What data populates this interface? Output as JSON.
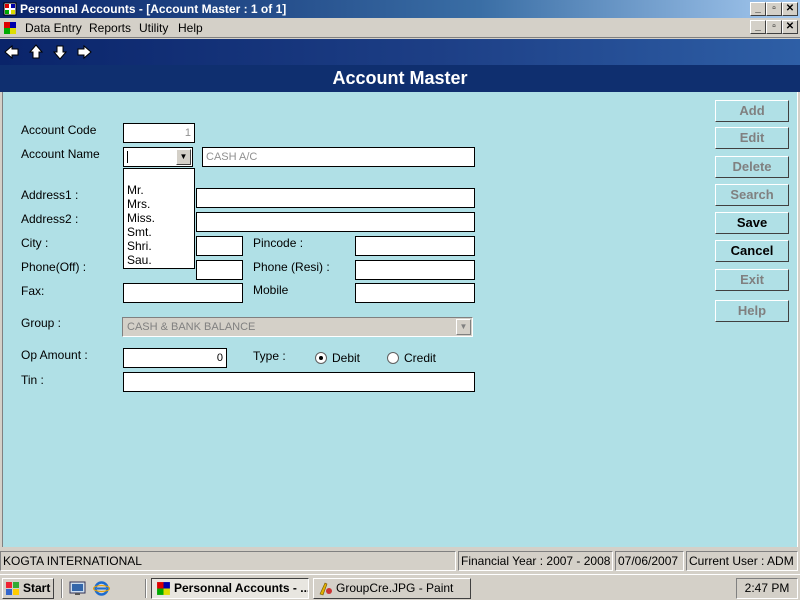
{
  "window": {
    "title": "Personnal Accounts - [Account Master : 1 of  1]",
    "minimize_icon": "minimize-icon",
    "restore_icon": "restore-icon",
    "close_icon": "close-icon"
  },
  "menu": {
    "items": [
      {
        "label": "Data Entry"
      },
      {
        "label": "Reports"
      },
      {
        "label": "Utility"
      },
      {
        "label": "Help"
      }
    ]
  },
  "nav": {
    "icons": [
      "arrow-left-icon",
      "arrow-up-icon",
      "arrow-down-icon",
      "arrow-right-icon"
    ]
  },
  "form": {
    "heading": "Account Master",
    "account_code_label": "Account Code",
    "account_code_value": "1",
    "account_name_label": "Account Name",
    "account_name_value": "CASH A/C",
    "salutation_options": [
      "Mr.",
      "Mrs.",
      "Miss.",
      "Smt.",
      "Shri.",
      "Sau."
    ],
    "address1_label": "Address1 :",
    "address2_label": "Address2 :",
    "city_label": "City :",
    "pincode_label": "Pincode :",
    "phone_off_label": "Phone(Off) :",
    "phone_resi_label": "Phone (Resi) :",
    "fax_label": "Fax:",
    "mobile_label": "Mobile",
    "group_label": "Group :",
    "group_value": "CASH & BANK BALANCE",
    "op_amount_label": "Op Amount :",
    "op_amount_value": "0",
    "type_label": "Type :",
    "type_debit": "Debit",
    "type_credit": "Credit",
    "type_selected": "Debit",
    "tin_label": "Tin :"
  },
  "buttons": {
    "add": "Add",
    "edit": "Edit",
    "delete": "Delete",
    "search": "Search",
    "save": "Save",
    "cancel": "Cancel",
    "exit": "Exit",
    "help": "Help"
  },
  "status": {
    "company": "KOGTA INTERNATIONAL",
    "financial_year": "Financial Year : 2007 - 2008",
    "date": "07/06/2007",
    "user": "Current User : ADM"
  },
  "taskbar": {
    "start": "Start",
    "task1": "Personnal Accounts - ...",
    "task2": "GroupCre.JPG - Paint",
    "clock": "2:47 PM"
  },
  "colors": {
    "form_background": "#b0e0e6",
    "header_background": "#0f2f6f",
    "title_gradient_start": "#0a246a"
  }
}
